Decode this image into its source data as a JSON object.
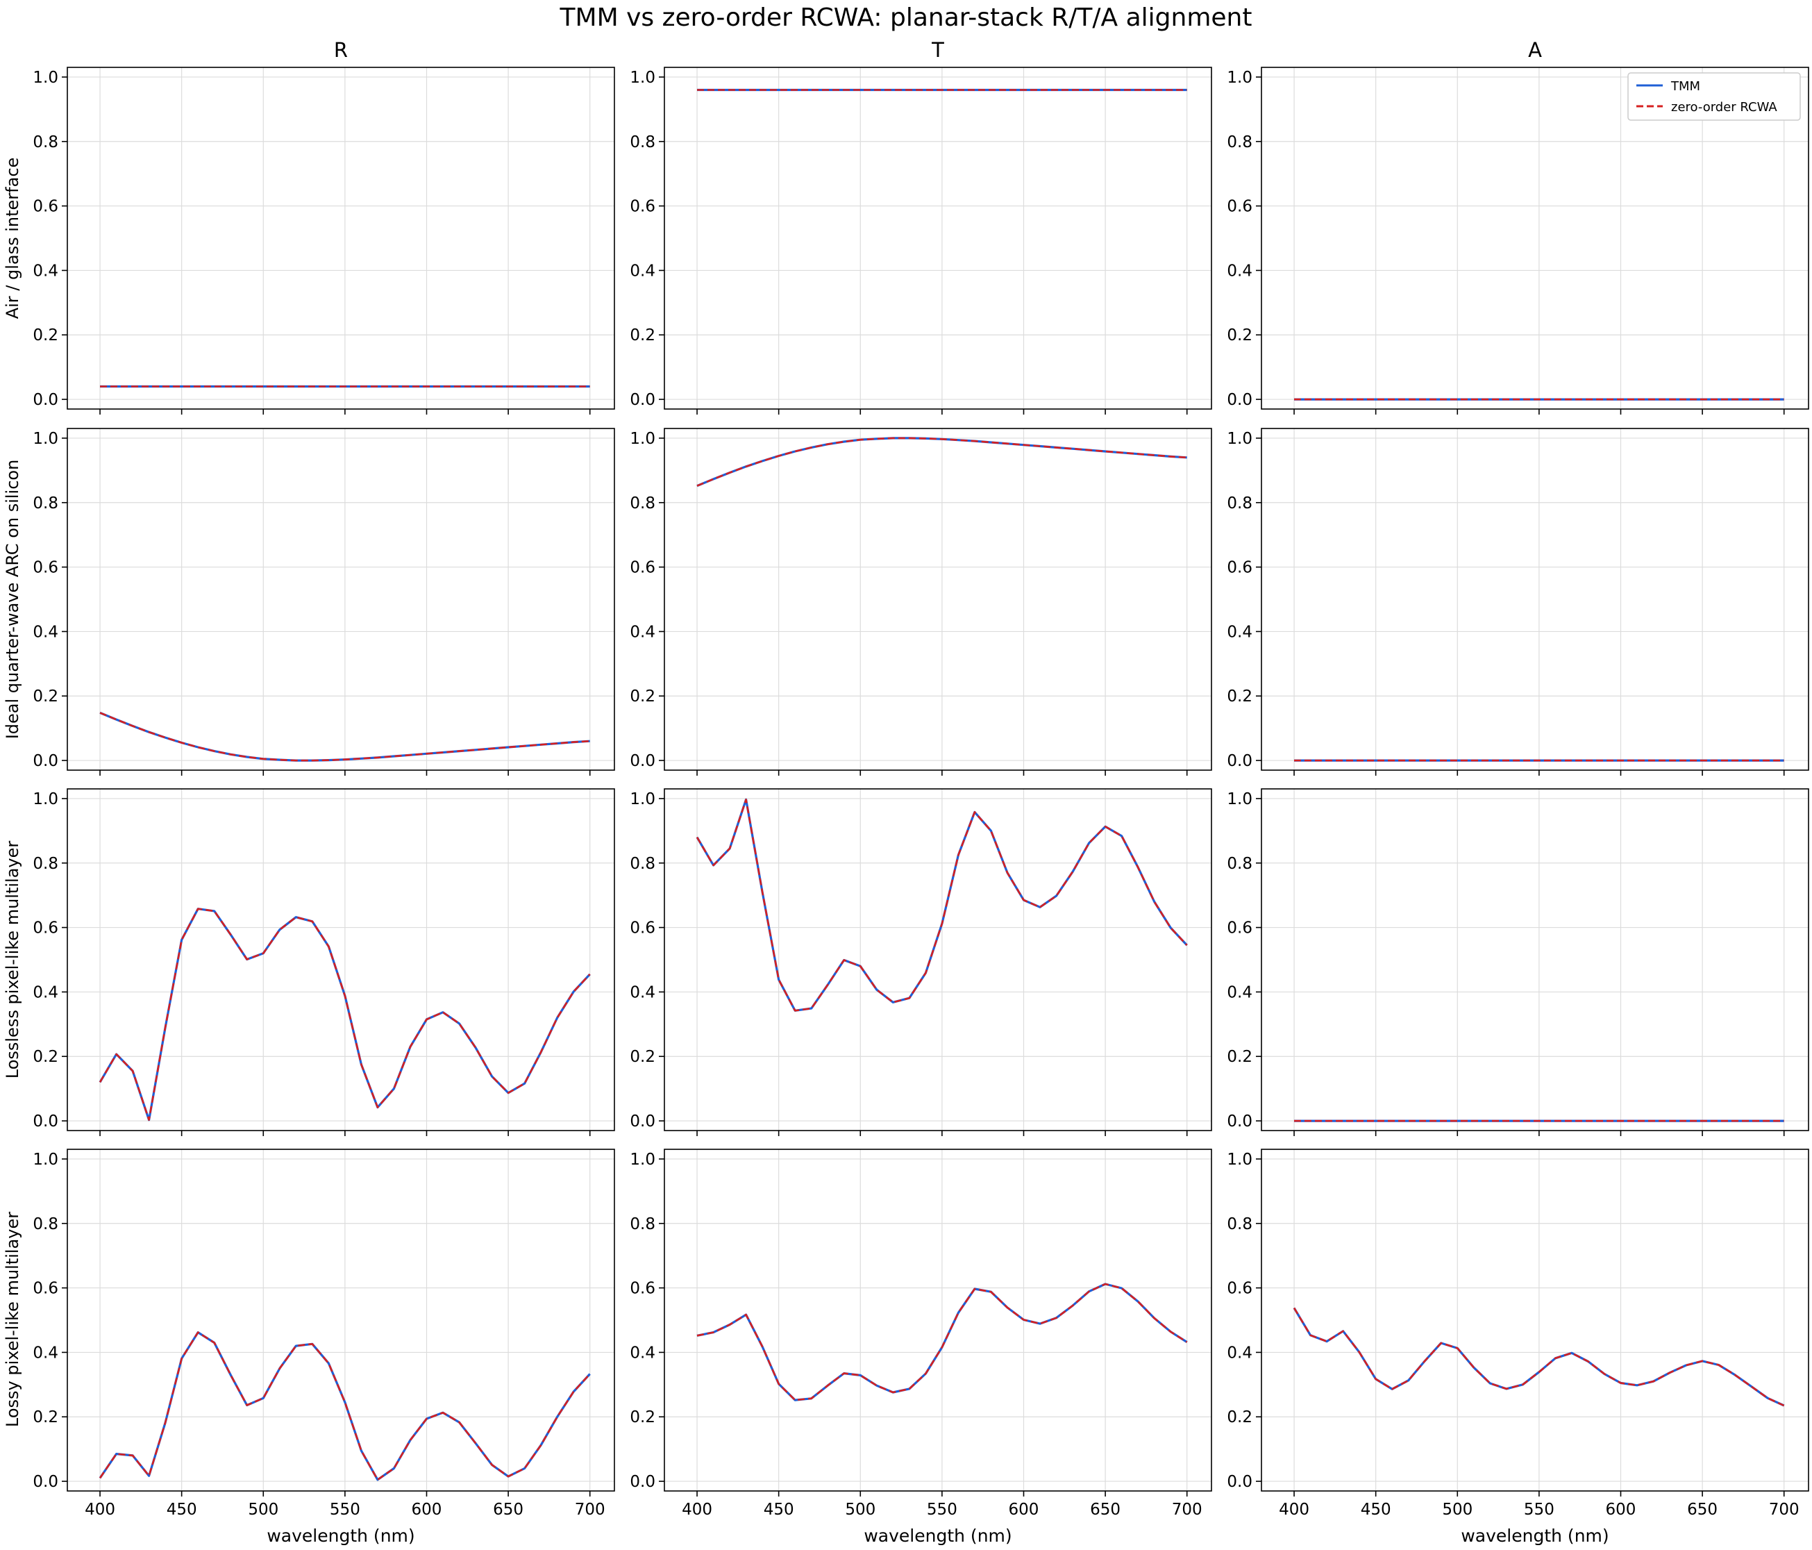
{
  "figure": {
    "title": "TMM vs zero-order RCWA: planar-stack R/T/A alignment",
    "column_titles": [
      "R",
      "T",
      "A"
    ],
    "row_labels": [
      "Air / glass interface",
      "Ideal quarter-wave ARC on silicon",
      "Lossless pixel-like multilayer",
      "Lossy pixel-like multilayer"
    ],
    "xlabel": "wavelength (nm)",
    "colors": {
      "tmm": "#1f5fd6",
      "rcwa": "#d62020"
    },
    "legend": {
      "items": [
        "TMM",
        "zero-order RCWA"
      ],
      "placement": "top-right of A panel, first row"
    }
  },
  "chart_data": {
    "type": "line",
    "grid": true,
    "xlim": [
      380,
      715
    ],
    "ylim": [
      -0.03,
      1.03
    ],
    "xticks": [
      400,
      450,
      500,
      550,
      600,
      650,
      700
    ],
    "yticks": [
      0.0,
      0.2,
      0.4,
      0.6,
      0.8,
      1.0
    ],
    "xtick_labels": [
      "400",
      "450",
      "500",
      "550",
      "600",
      "650",
      "700"
    ],
    "ytick_labels": [
      "0.0",
      "0.2",
      "0.4",
      "0.6",
      "0.8",
      "1.0"
    ],
    "x": [
      400,
      410,
      420,
      430,
      440,
      450,
      460,
      470,
      480,
      490,
      500,
      510,
      520,
      530,
      540,
      550,
      560,
      570,
      580,
      590,
      600,
      610,
      620,
      630,
      640,
      650,
      660,
      670,
      680,
      690,
      700
    ],
    "series_names": [
      "TMM",
      "zero-order RCWA"
    ],
    "panels": [
      {
        "row": 0,
        "col": 0,
        "values": [
          0.04,
          0.04,
          0.04,
          0.04,
          0.04,
          0.04,
          0.04,
          0.04,
          0.04,
          0.04,
          0.04,
          0.04,
          0.04,
          0.04,
          0.04,
          0.04,
          0.04,
          0.04,
          0.04,
          0.04,
          0.04,
          0.04,
          0.04,
          0.04,
          0.04,
          0.04,
          0.04,
          0.04,
          0.04,
          0.04,
          0.04
        ]
      },
      {
        "row": 0,
        "col": 1,
        "values": [
          0.96,
          0.96,
          0.96,
          0.96,
          0.96,
          0.96,
          0.96,
          0.96,
          0.96,
          0.96,
          0.96,
          0.96,
          0.96,
          0.96,
          0.96,
          0.96,
          0.96,
          0.96,
          0.96,
          0.96,
          0.96,
          0.96,
          0.96,
          0.96,
          0.96,
          0.96,
          0.96,
          0.96,
          0.96,
          0.96,
          0.96
        ]
      },
      {
        "row": 0,
        "col": 2,
        "values": [
          0,
          0,
          0,
          0,
          0,
          0,
          0,
          0,
          0,
          0,
          0,
          0,
          0,
          0,
          0,
          0,
          0,
          0,
          0,
          0,
          0,
          0,
          0,
          0,
          0,
          0,
          0,
          0,
          0,
          0,
          0
        ]
      },
      {
        "row": 1,
        "col": 0,
        "values": [
          0.148,
          0.127,
          0.107,
          0.088,
          0.071,
          0.055,
          0.041,
          0.029,
          0.019,
          0.011,
          0.005,
          0.002,
          0.0,
          0.0,
          0.001,
          0.003,
          0.006,
          0.009,
          0.013,
          0.017,
          0.021,
          0.025,
          0.029,
          0.033,
          0.037,
          0.041,
          0.045,
          0.049,
          0.053,
          0.057,
          0.06
        ]
      },
      {
        "row": 1,
        "col": 1,
        "values": [
          0.852,
          0.873,
          0.893,
          0.912,
          0.929,
          0.945,
          0.959,
          0.971,
          0.981,
          0.989,
          0.995,
          0.998,
          1.0,
          1.0,
          0.999,
          0.997,
          0.994,
          0.991,
          0.987,
          0.983,
          0.979,
          0.975,
          0.971,
          0.967,
          0.963,
          0.959,
          0.955,
          0.951,
          0.947,
          0.943,
          0.94
        ]
      },
      {
        "row": 1,
        "col": 2,
        "values": [
          0,
          0,
          0,
          0,
          0,
          0,
          0,
          0,
          0,
          0,
          0,
          0,
          0,
          0,
          0,
          0,
          0,
          0,
          0,
          0,
          0,
          0,
          0,
          0,
          0,
          0,
          0,
          0,
          0,
          0,
          0
        ]
      },
      {
        "row": 2,
        "col": 0,
        "values": [
          0.12,
          0.207,
          0.155,
          0.003,
          0.29,
          0.562,
          0.658,
          0.651,
          0.578,
          0.501,
          0.52,
          0.593,
          0.632,
          0.619,
          0.541,
          0.388,
          0.175,
          0.042,
          0.1,
          0.23,
          0.315,
          0.337,
          0.302,
          0.227,
          0.138,
          0.087,
          0.116,
          0.213,
          0.32,
          0.401,
          0.455
        ]
      },
      {
        "row": 2,
        "col": 1,
        "values": [
          0.88,
          0.793,
          0.845,
          0.997,
          0.71,
          0.438,
          0.342,
          0.349,
          0.422,
          0.499,
          0.48,
          0.407,
          0.368,
          0.381,
          0.459,
          0.612,
          0.825,
          0.958,
          0.9,
          0.77,
          0.685,
          0.663,
          0.698,
          0.773,
          0.862,
          0.913,
          0.884,
          0.787,
          0.68,
          0.599,
          0.545
        ]
      },
      {
        "row": 2,
        "col": 2,
        "values": [
          0,
          0,
          0,
          0,
          0,
          0,
          0,
          0,
          0,
          0,
          0,
          0,
          0,
          0,
          0,
          0,
          0,
          0,
          0,
          0,
          0,
          0,
          0,
          0,
          0,
          0,
          0,
          0,
          0,
          0,
          0
        ]
      },
      {
        "row": 3,
        "col": 0,
        "values": [
          0.01,
          0.085,
          0.08,
          0.017,
          0.182,
          0.381,
          0.462,
          0.43,
          0.33,
          0.236,
          0.258,
          0.35,
          0.42,
          0.426,
          0.366,
          0.245,
          0.095,
          0.005,
          0.04,
          0.128,
          0.194,
          0.213,
          0.183,
          0.118,
          0.051,
          0.015,
          0.04,
          0.112,
          0.2,
          0.278,
          0.333
        ]
      },
      {
        "row": 3,
        "col": 1,
        "values": [
          0.452,
          0.462,
          0.486,
          0.517,
          0.418,
          0.302,
          0.252,
          0.257,
          0.297,
          0.335,
          0.329,
          0.297,
          0.276,
          0.287,
          0.334,
          0.416,
          0.523,
          0.597,
          0.588,
          0.539,
          0.501,
          0.489,
          0.507,
          0.545,
          0.589,
          0.612,
          0.599,
          0.558,
          0.506,
          0.464,
          0.432
        ]
      },
      {
        "row": 3,
        "col": 2,
        "values": [
          0.538,
          0.453,
          0.434,
          0.466,
          0.4,
          0.317,
          0.286,
          0.313,
          0.373,
          0.429,
          0.413,
          0.353,
          0.304,
          0.287,
          0.3,
          0.339,
          0.382,
          0.398,
          0.372,
          0.333,
          0.305,
          0.298,
          0.31,
          0.337,
          0.36,
          0.373,
          0.361,
          0.33,
          0.294,
          0.258,
          0.235
        ]
      }
    ]
  }
}
